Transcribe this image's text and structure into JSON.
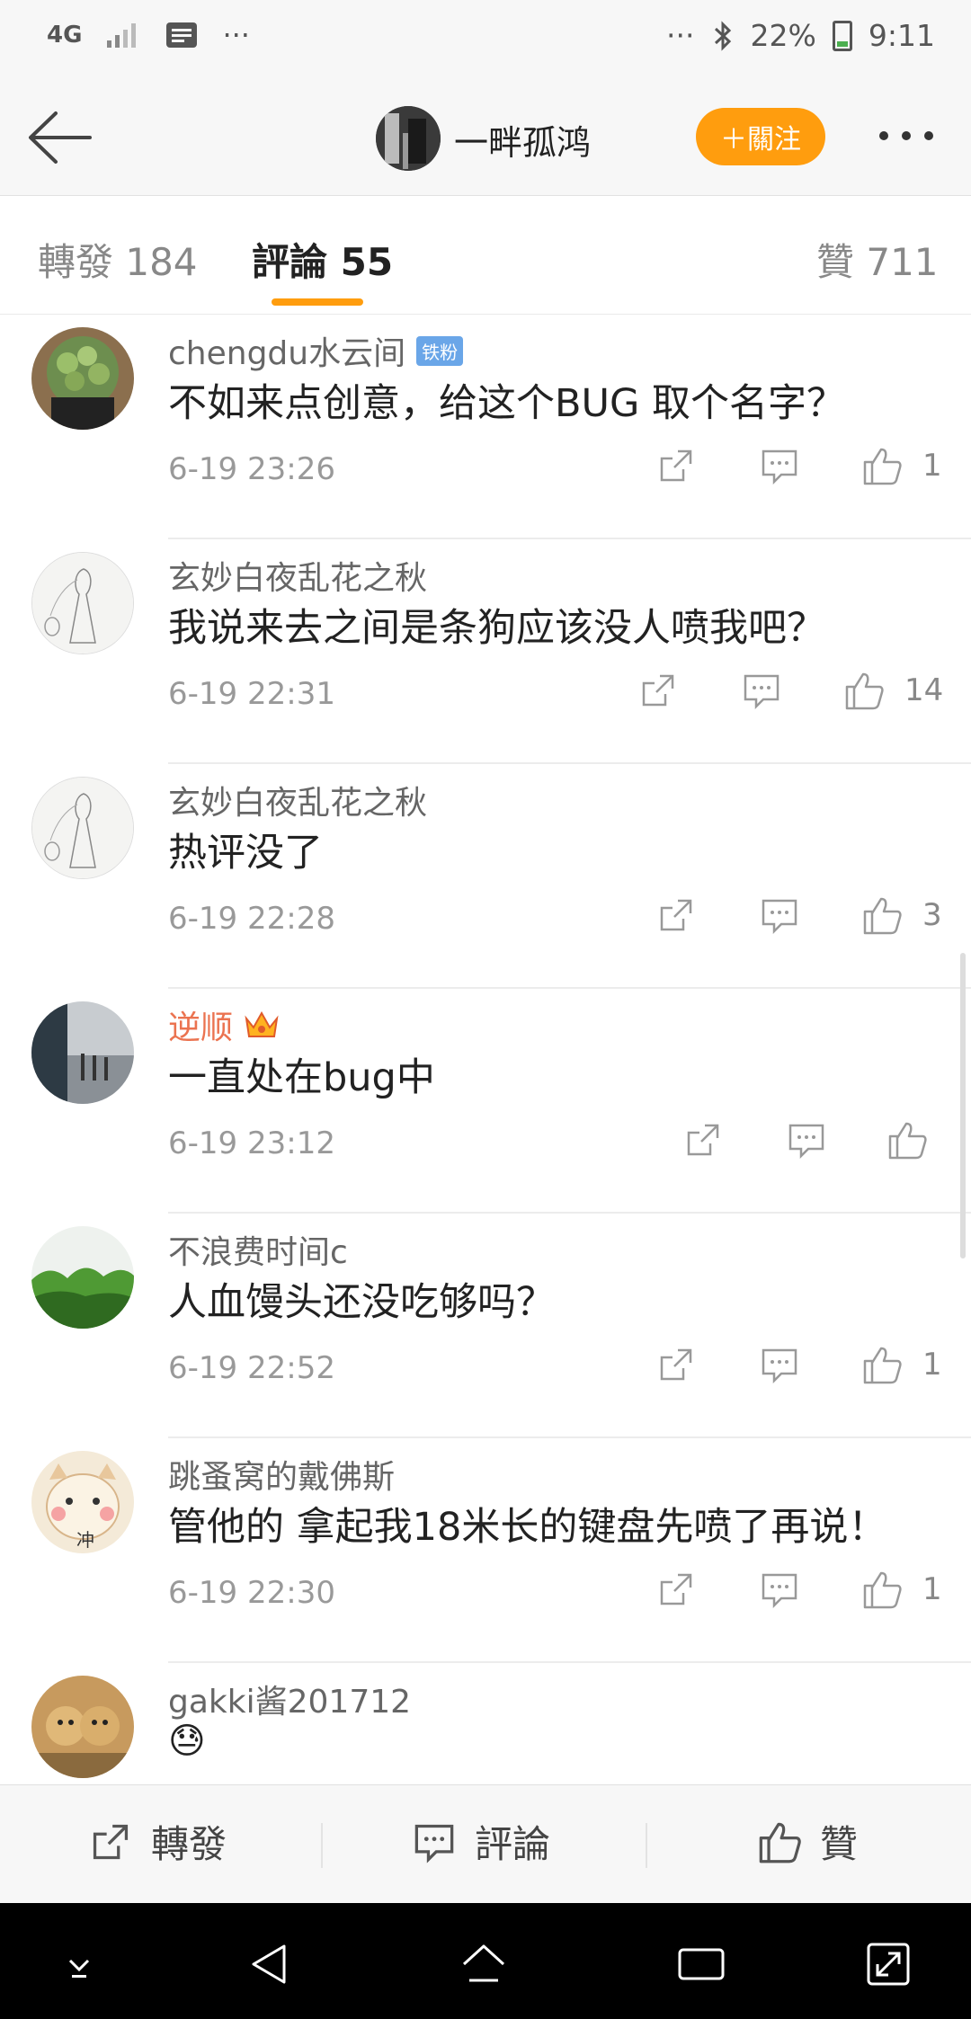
{
  "status_bar": {
    "network": "4G",
    "signal_icon": "signal-bars-icon",
    "message_icon": "message-notification-icon",
    "left_dots": "···",
    "right_dots": "···",
    "battery": "22%",
    "time": "9:11"
  },
  "header": {
    "name": "一畔孤鸿",
    "follow_label": "＋關注"
  },
  "tabs": {
    "reposts": "轉發 184",
    "comments": "評論 55",
    "likes": "贊 711"
  },
  "comments": [
    {
      "name": "chengdu水云间",
      "badge": "铁粉",
      "text": "不如来点创意，给这个BUG 取个名字？",
      "time": "6-19 23:26",
      "likes": "1"
    },
    {
      "name": "玄妙白夜乱花之秋",
      "text": "我说来去之间是条狗应该没人喷我吧？",
      "time": "6-19 22:31",
      "likes": "14"
    },
    {
      "name": "玄妙白夜乱花之秋",
      "text": "热评没了",
      "time": "6-19 22:28",
      "likes": "3"
    },
    {
      "name": "逆顺",
      "text": "一直处在bug中",
      "time": "6-19 23:12",
      "likes": ""
    },
    {
      "name": "不浪费时间c",
      "text": "人血馒头还没吃够吗？",
      "time": "6-19 22:52",
      "likes": "1"
    },
    {
      "name": "跳蚤窝的戴佛斯",
      "text": "管他的 拿起我18米长的键盘先喷了再说！",
      "time": "6-19 22:30",
      "likes": "1"
    },
    {
      "name": "gakki酱201712",
      "text": "😓"
    }
  ],
  "action_bar": {
    "repost": "轉發",
    "comment": "評論",
    "like": "贊"
  },
  "avatar_text": "冲",
  "colors": {
    "accent": "#ff9d0e",
    "vip_name": "#eb7350",
    "badge": "#6aa6e8"
  }
}
